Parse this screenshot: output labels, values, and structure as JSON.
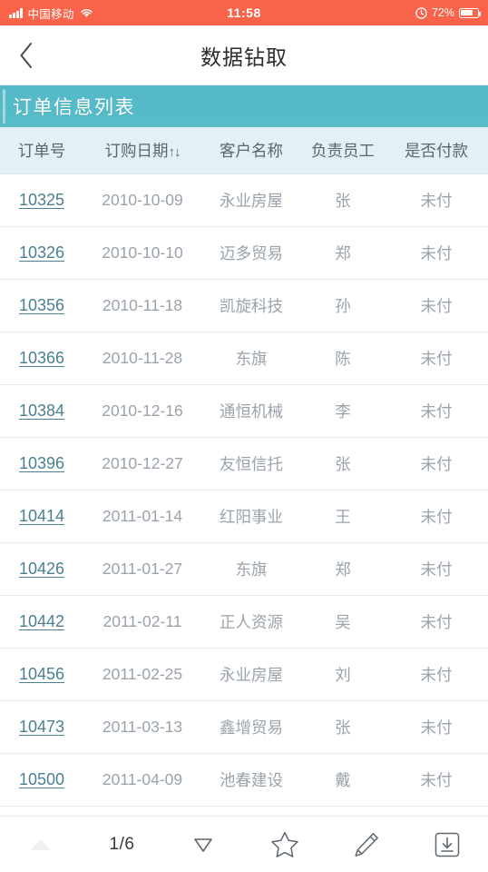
{
  "statusbar": {
    "carrier": "中国移动",
    "time": "11:58",
    "battery_percent": "72%",
    "wifi_icon": "wifi-icon",
    "signal_icon": "signal-bars-icon",
    "alarm_icon": "alarm-clock-icon",
    "battery_icon": "battery-icon",
    "accent_color": "#f8634a"
  },
  "navbar": {
    "back_icon": "chevron-left-icon",
    "title": "数据钻取"
  },
  "section": {
    "title": "订单信息列表",
    "accent_color": "#56bcc9"
  },
  "table": {
    "columns": [
      {
        "key": "id",
        "label": "订单号"
      },
      {
        "key": "date",
        "label": "订购日期",
        "sort": "↑↓"
      },
      {
        "key": "cust",
        "label": "客户名称"
      },
      {
        "key": "emp",
        "label": "负责员工"
      },
      {
        "key": "pay",
        "label": "是否付款"
      }
    ],
    "rows": [
      {
        "id": "10325",
        "date": "2010-10-09",
        "cust": "永业房屋",
        "emp": "张",
        "pay": "未付"
      },
      {
        "id": "10326",
        "date": "2010-10-10",
        "cust": "迈多贸易",
        "emp": "郑",
        "pay": "未付"
      },
      {
        "id": "10356",
        "date": "2010-11-18",
        "cust": "凯旋科技",
        "emp": "孙",
        "pay": "未付"
      },
      {
        "id": "10366",
        "date": "2010-11-28",
        "cust": "东旗",
        "emp": "陈",
        "pay": "未付"
      },
      {
        "id": "10384",
        "date": "2010-12-16",
        "cust": "通恒机械",
        "emp": "李",
        "pay": "未付"
      },
      {
        "id": "10396",
        "date": "2010-12-27",
        "cust": "友恒信托",
        "emp": "张",
        "pay": "未付"
      },
      {
        "id": "10414",
        "date": "2011-01-14",
        "cust": "红阳事业",
        "emp": "王",
        "pay": "未付"
      },
      {
        "id": "10426",
        "date": "2011-01-27",
        "cust": "东旗",
        "emp": "郑",
        "pay": "未付"
      },
      {
        "id": "10442",
        "date": "2011-02-11",
        "cust": "正人资源",
        "emp": "吴",
        "pay": "未付"
      },
      {
        "id": "10456",
        "date": "2011-02-25",
        "cust": "永业房屋",
        "emp": "刘",
        "pay": "未付"
      },
      {
        "id": "10473",
        "date": "2011-03-13",
        "cust": "鑫增贸易",
        "emp": "张",
        "pay": "未付"
      },
      {
        "id": "10500",
        "date": "2011-04-09",
        "cust": "池春建设",
        "emp": "戴",
        "pay": "未付"
      }
    ]
  },
  "bottombar": {
    "prev_icon": "triangle-up-icon",
    "page_indicator": "1/6",
    "next_icon": "triangle-down-icon",
    "favorite_icon": "star-icon",
    "edit_icon": "pencil-icon",
    "download_icon": "download-icon"
  }
}
